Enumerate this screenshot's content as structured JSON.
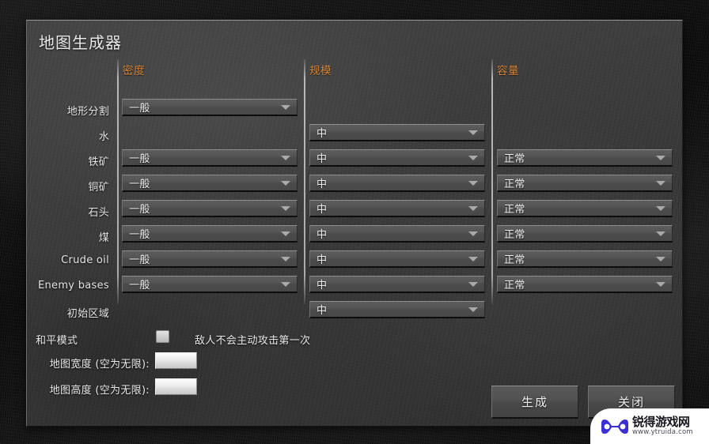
{
  "dialog": {
    "title": "地图生成器"
  },
  "columns": [
    {
      "id": "density",
      "label": "密度"
    },
    {
      "id": "scale",
      "label": "规模"
    },
    {
      "id": "capacity",
      "label": "容量"
    }
  ],
  "rows": [
    {
      "label": "地形分割",
      "density": "一般",
      "scale": null,
      "capacity": null
    },
    {
      "label": "水",
      "density": null,
      "scale": "中",
      "capacity": null
    },
    {
      "label": "铁矿",
      "density": "一般",
      "scale": "中",
      "capacity": "正常"
    },
    {
      "label": "铜矿",
      "density": "一般",
      "scale": "中",
      "capacity": "正常"
    },
    {
      "label": "石头",
      "density": "一般",
      "scale": "中",
      "capacity": "正常"
    },
    {
      "label": "煤",
      "density": "一般",
      "scale": "中",
      "capacity": "正常"
    },
    {
      "label": "Crude oil",
      "density": "一般",
      "scale": "中",
      "capacity": "正常"
    },
    {
      "label": "Enemy bases",
      "density": "一般",
      "scale": "中",
      "capacity": "正常"
    },
    {
      "label": "初始区域",
      "density": null,
      "scale": "中",
      "capacity": null
    }
  ],
  "options": {
    "peaceful_mode_label": "和平模式",
    "peaceful_mode_hint": "敌人不会主动攻击第一次",
    "peaceful_mode_checked": false,
    "map_width_label": "地图宽度 (空为无限):",
    "map_width_value": "",
    "map_height_label": "地图高度 (空为无限):",
    "map_height_value": ""
  },
  "buttons": {
    "generate": "生成",
    "close": "关闭"
  },
  "watermark": {
    "name": "锐得游戏网",
    "url": "www.ytruida.com"
  },
  "colors": {
    "header_accent": "#d8873a",
    "dialog_bg": "#3a3a3a",
    "text": "#e8e8e8",
    "watermark_logo": "#3b2fd4"
  }
}
